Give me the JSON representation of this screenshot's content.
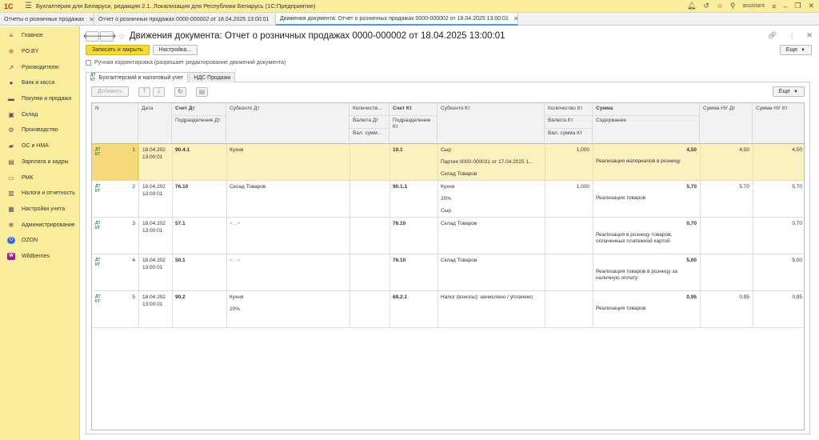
{
  "app": {
    "logo": "1С",
    "title": "Бухгалтерия для Беларуси, редакция 2.1. Локализация для Республики Беларусь   (1С:Предприятие)",
    "user": "assistant"
  },
  "window_tabs": [
    {
      "label": "Отчеты о розничных продажах"
    },
    {
      "label": "Отчет о розничных продажах 0000-000002 от 18.04.2025 13:00:01"
    },
    {
      "label": "Движения документа: Отчет о розничных продажах 0000-000002 от 18.04.2025 13:00:01"
    }
  ],
  "sidebar": {
    "items": [
      {
        "label": "Главное",
        "icon": "menu-icon"
      },
      {
        "label": "PO.BY",
        "icon": "poby-icon"
      },
      {
        "label": "Руководителю",
        "icon": "chart-icon"
      },
      {
        "label": "Банк и касса",
        "icon": "bank-icon"
      },
      {
        "label": "Покупки и продажи",
        "icon": "cart-icon"
      },
      {
        "label": "Склад",
        "icon": "warehouse-icon"
      },
      {
        "label": "Производство",
        "icon": "factory-icon"
      },
      {
        "label": "ОС и НМА",
        "icon": "assets-icon"
      },
      {
        "label": "Зарплата и кадры",
        "icon": "salary-icon"
      },
      {
        "label": "РМК",
        "icon": "cashier-icon"
      },
      {
        "label": "Налоги и отчетность",
        "icon": "tax-icon"
      },
      {
        "label": "Настройки учета",
        "icon": "settings-icon"
      },
      {
        "label": "Администрирование",
        "icon": "gear-icon"
      },
      {
        "label": "OZON",
        "icon": "ozon-icon"
      },
      {
        "label": "Wildberries",
        "icon": "wildberries-icon"
      }
    ]
  },
  "page": {
    "title": "Движения документа: Отчет о розничных продажах 0000-000002 от 18.04.2025 13:00:01",
    "save_close": "Записать и закрыть",
    "settings": "Настройка...",
    "more": "Еще",
    "manual_adjust": "Ручная корректировка (разрешает редактирование движений документа)",
    "tabs": [
      "Бухгалтерский и налоговый учет",
      "НДС Продажи"
    ],
    "add": "Добавить",
    "more2": "Еще"
  },
  "grid": {
    "headers": {
      "n": "N",
      "date": "Дата",
      "acc_dt": "Счет Дт",
      "div_dt": "Подразделение Дт",
      "sub_dt": "Субконто Дт",
      "qty_dt": "Количеств...",
      "cur_dt": "Валюта Дт",
      "cur_sum_dt": "Вал. сумм...",
      "acc_kt": "Счет Кт",
      "div_kt": "Подразделение Кт",
      "sub_kt": "Субконто Кт",
      "qty_kt": "Количество Кт",
      "cur_kt": "Валюта Кт",
      "cur_sum_kt": "Вал. сумма Кт",
      "sum": "Сумма",
      "content": "Содержание",
      "sum_nu_dt": "Сумма НУ Дт",
      "sum_nu_kt": "Сумма НУ Кт"
    },
    "rows": [
      {
        "n": "1",
        "date1": "18.04.202",
        "date2": "13:00:01",
        "acc_dt": "90.4.1",
        "sub_dt": [
          "Кухня"
        ],
        "acc_kt": "10.1",
        "sub_kt": [
          "Сыр",
          "Партия 0000-000031 от 17.04.2025 1...",
          "Склад Товаров"
        ],
        "qty_kt": "1,000",
        "sum": "4,50",
        "content": "Реализация материалов в розницу",
        "sum_nu_dt": "4,50",
        "sum_nu_kt": "4,50"
      },
      {
        "n": "2",
        "date1": "18.04.202",
        "date2": "13:00:01",
        "acc_dt": "76.10",
        "sub_dt": [
          "Склад Товаров"
        ],
        "acc_kt": "90.1.1",
        "sub_kt": [
          "Кухня",
          "20%",
          "Сыр"
        ],
        "qty_kt": "1,000",
        "sum": "5,70",
        "content": "Реализация товаров",
        "sum_nu_dt": "5,70",
        "sum_nu_kt": "5,70"
      },
      {
        "n": "3",
        "date1": "18.04.202",
        "date2": "13:00:01",
        "acc_dt": "57.1",
        "sub_dt": [
          "<...>"
        ],
        "acc_kt": "76.10",
        "sub_kt": [
          "Склад Товаров"
        ],
        "qty_kt": "",
        "sum": "0,70",
        "content": "Реализация в розницу товаров, оплаченных платежной картой",
        "sum_nu_dt": "",
        "sum_nu_kt": "0,70"
      },
      {
        "n": "4",
        "date1": "18.04.202",
        "date2": "13:00:01",
        "acc_dt": "50.1",
        "sub_dt": [
          "<...>"
        ],
        "acc_kt": "76.10",
        "sub_kt": [
          "Склад Товаров"
        ],
        "qty_kt": "",
        "sum": "5,00",
        "content": "Реализация товаров в розницу за наличную оплату",
        "sum_nu_dt": "",
        "sum_nu_kt": "5,00"
      },
      {
        "n": "5",
        "date1": "18.04.202",
        "date2": "13:00:01",
        "acc_dt": "90.2",
        "sub_dt": [
          "Кухня",
          "20%"
        ],
        "acc_kt": "68.2.1",
        "sub_kt": [
          "Налог (взносы): начислено / уплачено"
        ],
        "qty_kt": "",
        "sum": "0,95",
        "content": "Реализация товаров",
        "sum_nu_dt": "0,95",
        "sum_nu_kt": "0,95"
      }
    ]
  }
}
